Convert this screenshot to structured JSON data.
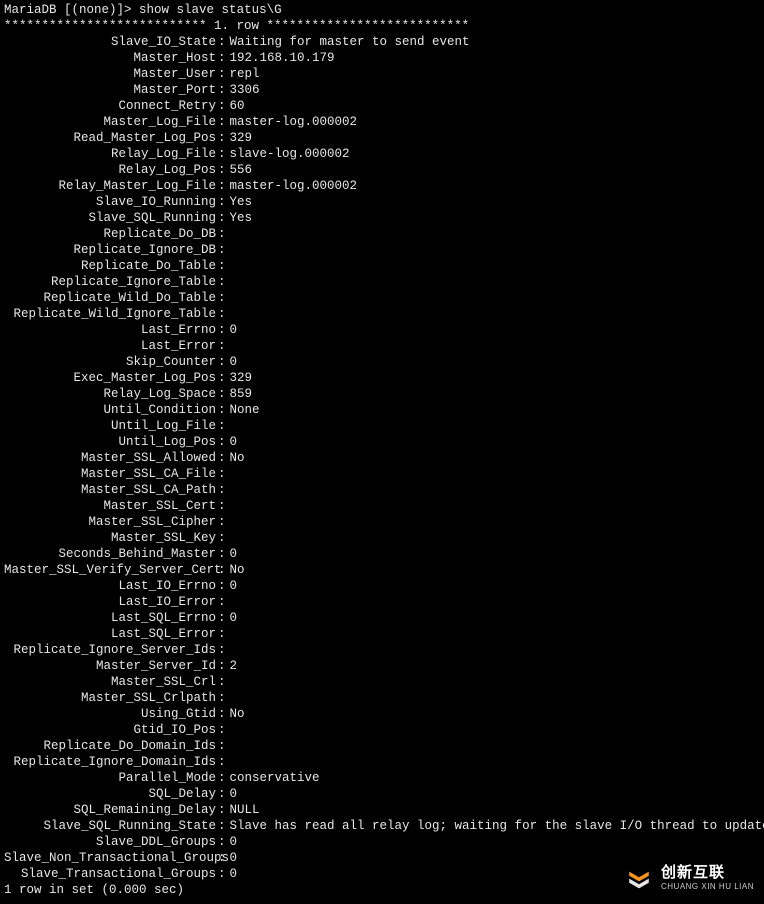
{
  "prompt": {
    "user_host": "MariaDB [(none)]>",
    "command": "show slave status\\G"
  },
  "row_header": "*************************** 1. row ***************************",
  "fields": [
    {
      "label": "Slave_IO_State",
      "value": "Waiting for master to send event"
    },
    {
      "label": "Master_Host",
      "value": "192.168.10.179"
    },
    {
      "label": "Master_User",
      "value": "repl"
    },
    {
      "label": "Master_Port",
      "value": "3306"
    },
    {
      "label": "Connect_Retry",
      "value": "60"
    },
    {
      "label": "Master_Log_File",
      "value": "master-log.000002"
    },
    {
      "label": "Read_Master_Log_Pos",
      "value": "329"
    },
    {
      "label": "Relay_Log_File",
      "value": "slave-log.000002"
    },
    {
      "label": "Relay_Log_Pos",
      "value": "556"
    },
    {
      "label": "Relay_Master_Log_File",
      "value": "master-log.000002"
    },
    {
      "label": "Slave_IO_Running",
      "value": "Yes"
    },
    {
      "label": "Slave_SQL_Running",
      "value": "Yes"
    },
    {
      "label": "Replicate_Do_DB",
      "value": ""
    },
    {
      "label": "Replicate_Ignore_DB",
      "value": ""
    },
    {
      "label": "Replicate_Do_Table",
      "value": ""
    },
    {
      "label": "Replicate_Ignore_Table",
      "value": ""
    },
    {
      "label": "Replicate_Wild_Do_Table",
      "value": ""
    },
    {
      "label": "Replicate_Wild_Ignore_Table",
      "value": ""
    },
    {
      "label": "Last_Errno",
      "value": "0"
    },
    {
      "label": "Last_Error",
      "value": ""
    },
    {
      "label": "Skip_Counter",
      "value": "0"
    },
    {
      "label": "Exec_Master_Log_Pos",
      "value": "329"
    },
    {
      "label": "Relay_Log_Space",
      "value": "859"
    },
    {
      "label": "Until_Condition",
      "value": "None"
    },
    {
      "label": "Until_Log_File",
      "value": ""
    },
    {
      "label": "Until_Log_Pos",
      "value": "0"
    },
    {
      "label": "Master_SSL_Allowed",
      "value": "No"
    },
    {
      "label": "Master_SSL_CA_File",
      "value": ""
    },
    {
      "label": "Master_SSL_CA_Path",
      "value": ""
    },
    {
      "label": "Master_SSL_Cert",
      "value": ""
    },
    {
      "label": "Master_SSL_Cipher",
      "value": ""
    },
    {
      "label": "Master_SSL_Key",
      "value": ""
    },
    {
      "label": "Seconds_Behind_Master",
      "value": "0"
    },
    {
      "label": "Master_SSL_Verify_Server_Cert",
      "value": "No"
    },
    {
      "label": "Last_IO_Errno",
      "value": "0"
    },
    {
      "label": "Last_IO_Error",
      "value": ""
    },
    {
      "label": "Last_SQL_Errno",
      "value": "0"
    },
    {
      "label": "Last_SQL_Error",
      "value": ""
    },
    {
      "label": "Replicate_Ignore_Server_Ids",
      "value": ""
    },
    {
      "label": "Master_Server_Id",
      "value": "2"
    },
    {
      "label": "Master_SSL_Crl",
      "value": ""
    },
    {
      "label": "Master_SSL_Crlpath",
      "value": ""
    },
    {
      "label": "Using_Gtid",
      "value": "No"
    },
    {
      "label": "Gtid_IO_Pos",
      "value": ""
    },
    {
      "label": "Replicate_Do_Domain_Ids",
      "value": ""
    },
    {
      "label": "Replicate_Ignore_Domain_Ids",
      "value": ""
    },
    {
      "label": "Parallel_Mode",
      "value": "conservative"
    },
    {
      "label": "SQL_Delay",
      "value": "0"
    },
    {
      "label": "SQL_Remaining_Delay",
      "value": "NULL"
    },
    {
      "label": "Slave_SQL_Running_State",
      "value": "Slave has read all relay log; waiting for the slave I/O thread to update it"
    },
    {
      "label": "Slave_DDL_Groups",
      "value": "0"
    },
    {
      "label": "Slave_Non_Transactional_Groups",
      "value": "0"
    },
    {
      "label": "Slave_Transactional_Groups",
      "value": "0"
    }
  ],
  "footer": "1 row in set (0.000 sec)",
  "watermark": {
    "cn": "创新互联",
    "en": "CHUANG XIN HU LIAN"
  }
}
